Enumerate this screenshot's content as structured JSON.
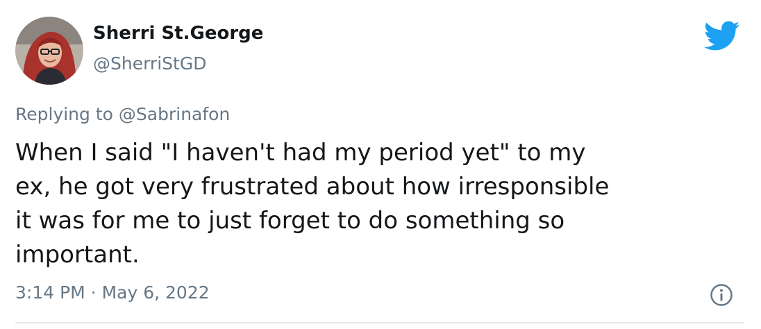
{
  "author": {
    "display_name": "Sherri St.George",
    "handle": "@SherriStGD",
    "avatar_icon": "profile-photo"
  },
  "reply": {
    "prefix": "Replying to",
    "mention": "@Sabrinafon"
  },
  "tweet": {
    "lines": [
      "When I said \"I haven't had my period yet\" to my",
      "ex, he got very frustrated about how irresponsible",
      "it was for me to just forget to do something so",
      "important."
    ],
    "timestamp": "3:14 PM · May 6, 2022"
  },
  "icons": {
    "brand": "twitter-bird-icon",
    "info": "info-icon"
  },
  "colors": {
    "brand_blue": "#1DA1F2",
    "secondary_text": "#657786",
    "primary_text": "#14171a",
    "divider": "#e1e8ed"
  }
}
